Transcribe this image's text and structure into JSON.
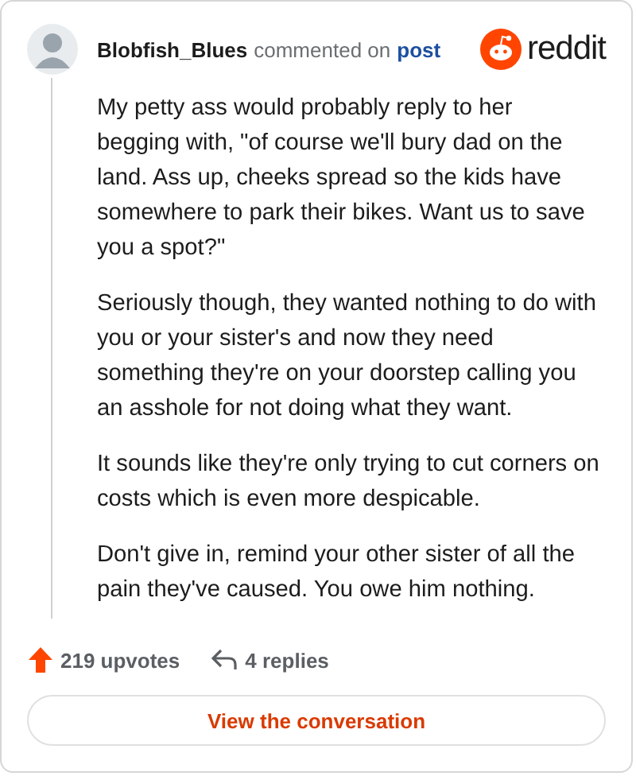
{
  "header": {
    "author": "Blobfish_Blues",
    "action": "commented on",
    "link": "post",
    "logo_text": "reddit"
  },
  "paragraphs": [
    "My petty ass would probably reply to her begging with, \"of course we'll bury dad on the land. Ass up, cheeks spread so the kids have somewhere to park their bikes. Want us to save you a spot?\"",
    "Seriously though, they wanted nothing to do with you or your sister's and now they need something they're on your doorstep calling you an asshole for not doing what they want.",
    "It sounds like they're only trying to cut corners on costs which is even more despicable.",
    "Don't give in, remind your other sister of all the pain they've caused. You owe him nothing."
  ],
  "footer": {
    "upvotes": "219 upvotes",
    "replies": "4 replies",
    "button": "View the conversation"
  }
}
